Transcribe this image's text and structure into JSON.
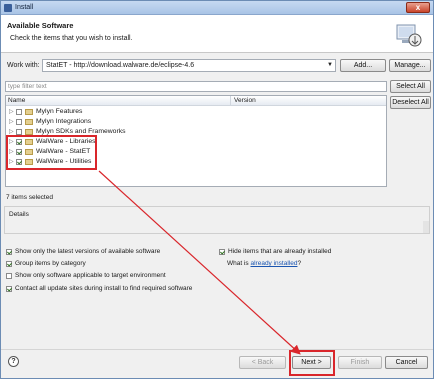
{
  "window": {
    "title": "Install",
    "close_glyph": "x"
  },
  "header": {
    "title": "Available Software",
    "subtitle": "Check the items that you wish to install.",
    "icon": "install-wizard-icon"
  },
  "work_with": {
    "label": "Work with:",
    "value": "StatET - http://download.walware.de/eclipse-4.6",
    "add_label": "Add...",
    "manage_label": "Manage..."
  },
  "filter": {
    "placeholder": "type filter text"
  },
  "buttons": {
    "select_all": "Select All",
    "deselect_all": "Deselect All"
  },
  "tree": {
    "columns": {
      "name": "Name",
      "version": "Version"
    },
    "items": [
      {
        "label": "Mylyn Features",
        "checked": false
      },
      {
        "label": "Mylyn Integrations",
        "checked": false
      },
      {
        "label": "Mylyn SDKs and Frameworks",
        "checked": false
      },
      {
        "label": "WalWare - Libraries",
        "checked": true
      },
      {
        "label": "WalWare - StatET",
        "checked": true
      },
      {
        "label": "WalWare - Utilities",
        "checked": true
      }
    ]
  },
  "status": {
    "items_selected": "7 items selected"
  },
  "details": {
    "label": "Details"
  },
  "options": {
    "latest_versions": {
      "label": "Show only the latest versions of available software",
      "checked": true
    },
    "hide_installed": {
      "label": "Hide items that are already installed",
      "checked": true
    },
    "group_by_category": {
      "label": "Group items by category",
      "checked": true
    },
    "what_is_prefix": "What is ",
    "already_installed_link": "already installed",
    "what_is_suffix": "?",
    "target_env": {
      "label": "Show only software applicable to target environment",
      "checked": false
    },
    "contact_sites": {
      "label": "Contact all update sites during install to find required software",
      "checked": true
    }
  },
  "footer": {
    "help_glyph": "?",
    "back_label": "< Back",
    "next_label": "Next >",
    "finish_label": "Finish",
    "cancel_label": "Cancel"
  },
  "colors": {
    "annotation": "#d9262b",
    "link": "#1a55b0"
  }
}
